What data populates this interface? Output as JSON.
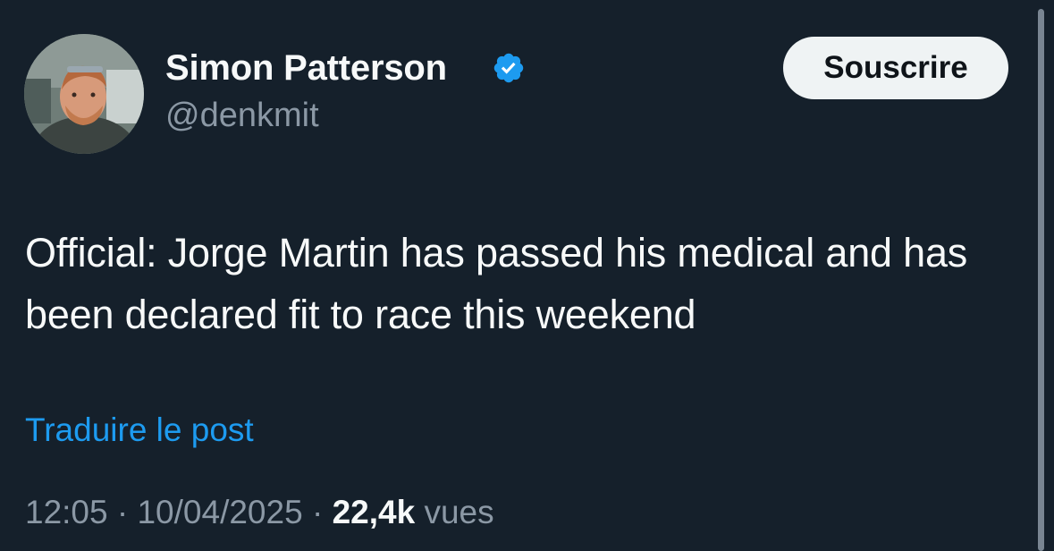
{
  "author": {
    "display_name": "Simon Patterson",
    "handle": "@denkmit",
    "verified": true,
    "verified_color": "#1d9bf0",
    "avatar_icon": "user-avatar-photo"
  },
  "actions": {
    "subscribe_label": "Souscrire"
  },
  "post": {
    "text": "Official: Jorge Martin has passed his medical and has been declared fit to race this weekend",
    "translate_label": "Traduire le post"
  },
  "meta": {
    "time": "12:05",
    "separator": "·",
    "date": "10/04/2025",
    "views_count": "22,4k",
    "views_label": "vues"
  },
  "colors": {
    "background": "#15202b",
    "text_primary": "#f7f9f9",
    "text_secondary": "#8b98a5",
    "link": "#1d9bf0",
    "button_bg": "#eff3f4",
    "button_text": "#0f1419"
  }
}
